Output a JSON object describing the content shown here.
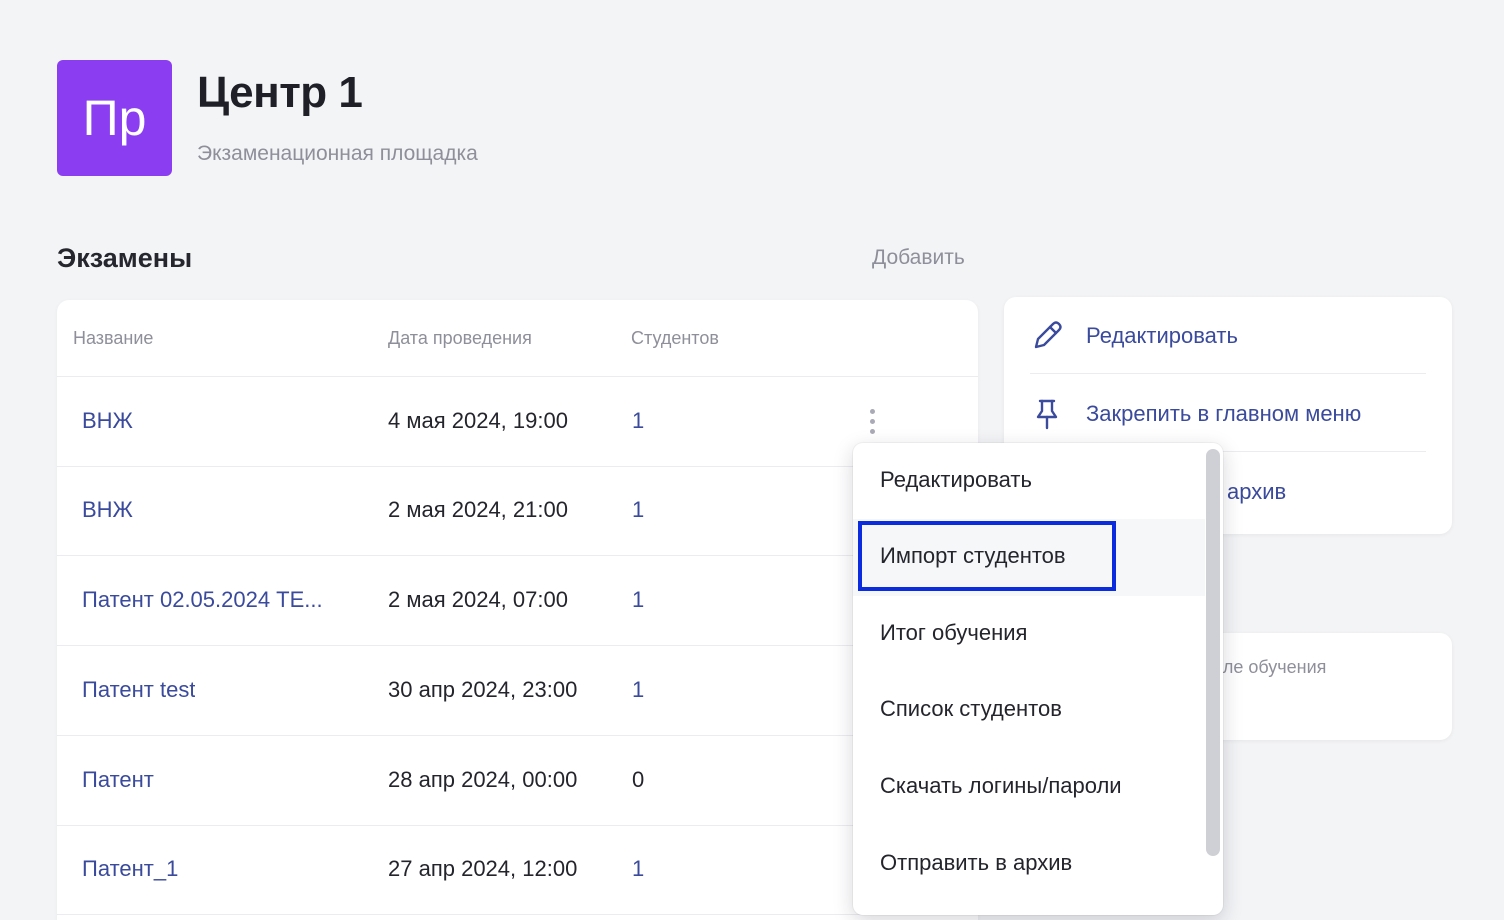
{
  "header": {
    "avatar_text": "Пр",
    "title": "Центр 1",
    "subtitle": "Экзаменационная площадка"
  },
  "exams": {
    "section_title": "Экзамены",
    "add_label": "Добавить",
    "columns": [
      "Название",
      "Дата проведения",
      "Студентов"
    ],
    "rows": [
      {
        "name": "ВНЖ",
        "date": "4 мая 2024, 19:00",
        "count": "1"
      },
      {
        "name": "ВНЖ",
        "date": "2 мая 2024, 21:00",
        "count": "1"
      },
      {
        "name": "Патент 02.05.2024 ТЕ...",
        "date": "2 мая 2024, 07:00",
        "count": "1"
      },
      {
        "name": "Патент test",
        "date": "30 апр 2024, 23:00",
        "count": "1"
      },
      {
        "name": "Патент",
        "date": "28 апр 2024, 00:00",
        "count": "0"
      },
      {
        "name": "Патент_1",
        "date": "27 апр 2024, 12:00",
        "count": "1"
      }
    ]
  },
  "side_actions": {
    "items": [
      {
        "label": "Редактировать",
        "icon": "pencil-icon"
      },
      {
        "label": "Закрепить в главном меню",
        "icon": "pin-icon"
      },
      {
        "label": "архив",
        "icon": "archive-icon"
      }
    ]
  },
  "info_card": {
    "text": "и после обучения"
  },
  "context_menu": {
    "items": [
      "Редактировать",
      "Импорт студентов",
      "Итог обучения",
      "Список студентов",
      "Скачать логины/пароли",
      "Отправить в архив"
    ],
    "highlighted_index": 1
  },
  "colors": {
    "accent": "#8b3df2",
    "link": "#3a4a9c",
    "focus": "#0a2cde",
    "background": "#f3f4f6"
  }
}
